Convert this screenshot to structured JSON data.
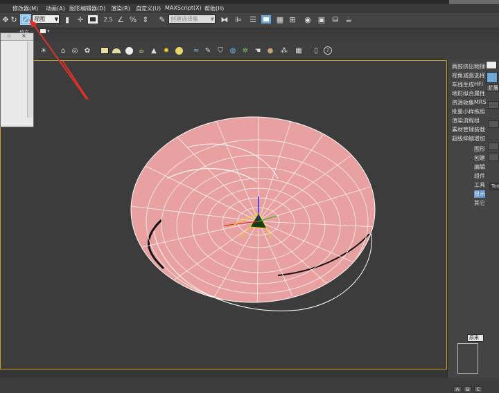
{
  "menubar": {
    "items": [
      "修改器(M)",
      "动画(A)",
      "图形编辑器(D)",
      "渲染(R)",
      "自定义(U)",
      "MAXScript(X)",
      "帮助(H)"
    ]
  },
  "toolbar": {
    "view_dropdown": "视图",
    "snap_label": "2.5",
    "percent_label": "%",
    "selection_set_placeholder": "创建选择集"
  },
  "ribbon_tab": "填充",
  "right_panel": {
    "col1": [
      "两鼓挤出",
      "视角减面",
      "车线生成",
      "地形拟合",
      "资源收集",
      "批量小样",
      "渲染流程",
      "素材管理",
      "超级伸缩"
    ],
    "col2": [
      "物理",
      "选择",
      "HFI",
      "属性",
      "MRS",
      "拖组",
      "组",
      "装载",
      "增加"
    ],
    "sub": [
      "图形",
      "创建",
      "编辑",
      "组件",
      "工具",
      "显示",
      "其它"
    ],
    "tabs": [
      "A",
      "B",
      "C"
    ],
    "bottom_dropdown": "原来",
    "tools_label": "Tools",
    "ext_label": "扩展"
  },
  "colors": {
    "selection_highlight": "#6da9d8",
    "viewport_border": "#c8a02a",
    "object_fill": "#e8a0a0",
    "wire": "#ffffff",
    "arrow": "#e0302a"
  }
}
